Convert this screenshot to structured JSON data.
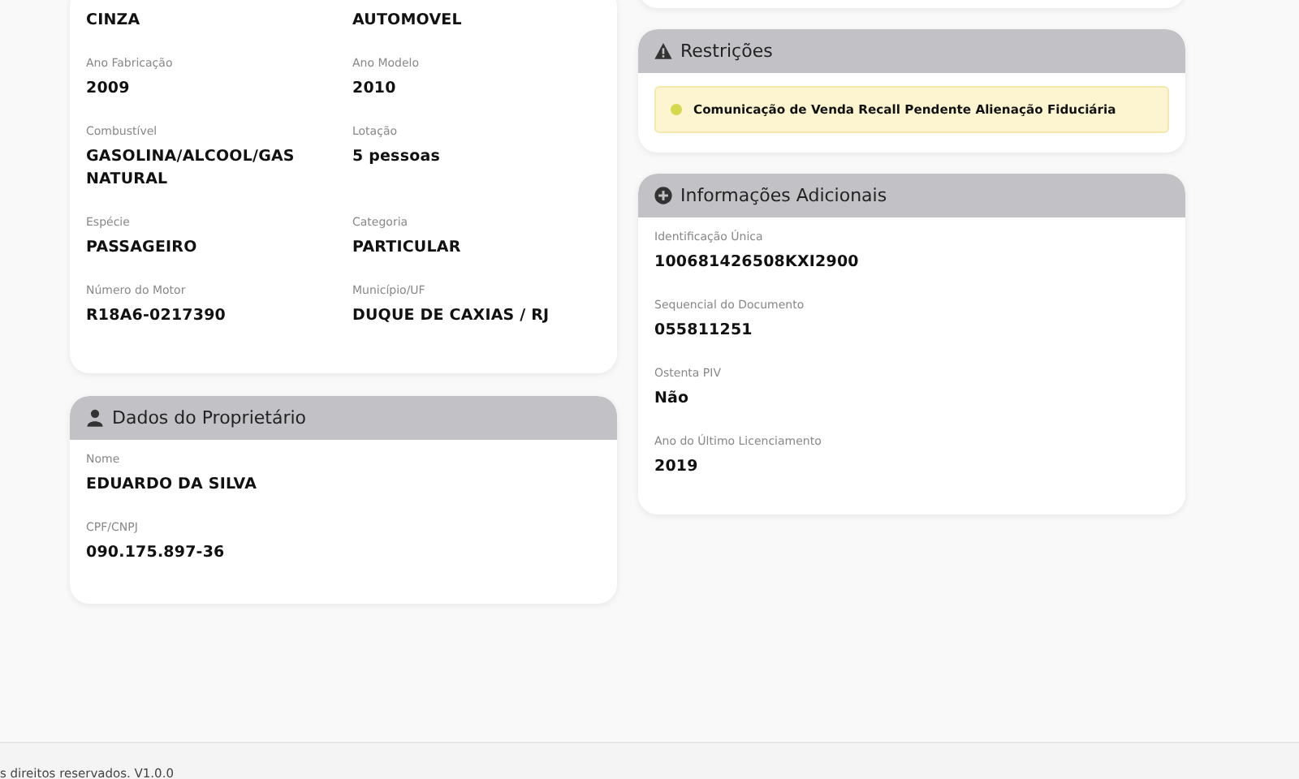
{
  "vehicle": {
    "fields": [
      {
        "value": "CINZA"
      },
      {
        "value": "AUTOMOVEL"
      },
      {
        "label": "Ano Fabricação",
        "value": "2009"
      },
      {
        "label": "Ano Modelo",
        "value": "2010"
      },
      {
        "label": "Combustível",
        "value": "GASOLINA/ALCOOL/GAS NATURAL"
      },
      {
        "label": "Lotação",
        "value": "5 pessoas"
      },
      {
        "label": "Espécie",
        "value": "PASSAGEIRO"
      },
      {
        "label": "Categoria",
        "value": "PARTICULAR"
      },
      {
        "label": "Número do Motor",
        "value": "R18A6-0217390"
      },
      {
        "label": "Município/UF",
        "value": "DUQUE DE CAXIAS / RJ"
      }
    ]
  },
  "owner": {
    "title": "Dados do Proprietário",
    "fields": [
      {
        "label": "Nome",
        "value": "EDUARDO DA SILVA"
      },
      {
        "label": "CPF/CNPJ",
        "value": "090.175.897-36"
      }
    ]
  },
  "restrictions": {
    "title": "Restrições",
    "items": [
      {
        "text": "Comunicação de Venda Recall Pendente Alienação Fiduciária",
        "color": "#d4d84a"
      }
    ]
  },
  "additional": {
    "title": "Informações Adicionais",
    "fields": [
      {
        "label": "Identificação Única",
        "value": "100681426508KXI2900"
      },
      {
        "label": "Sequencial do Documento",
        "value": "055811251"
      },
      {
        "label": "Ostenta PIV",
        "value": "Não"
      },
      {
        "label": "Ano do Último Licenciamento",
        "value": "2019"
      }
    ]
  },
  "footer": {
    "text": "s direitos reservados. V1.0.0"
  }
}
